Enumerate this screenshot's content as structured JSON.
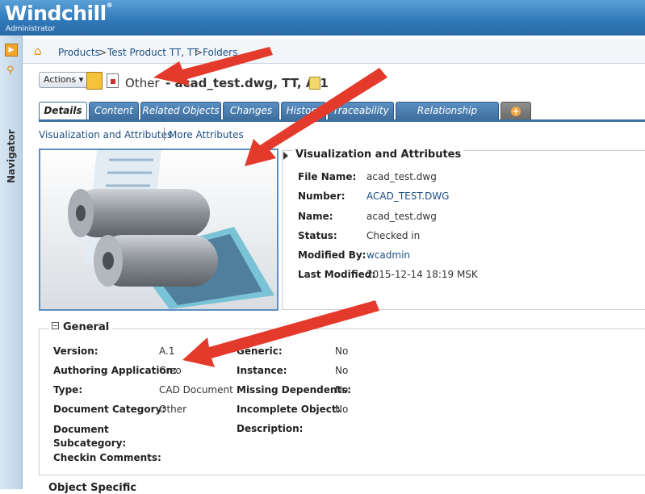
{
  "app": {
    "logo": "Windchill",
    "logo_mark": "®",
    "role": "Administrator"
  },
  "navigator": {
    "label": "Navigator"
  },
  "breadcrumb": {
    "items": [
      "Products",
      "Test Product TT, TT",
      "Folders"
    ],
    "separator": ">"
  },
  "toolbar": {
    "actions_label": "Actions"
  },
  "object": {
    "type": "Other",
    "dash": "-",
    "name": "acad_test.dwg, TT, A.1"
  },
  "tabs": [
    "Details",
    "Content",
    "Related Objects",
    "Changes",
    "History",
    "Traceability",
    "Relationship Explorer"
  ],
  "subnav": {
    "viz": "Visualization and Attributes",
    "more": "More Attributes"
  },
  "viz": {
    "title": "Visualization and Attributes",
    "rows": [
      {
        "label": "File Name:",
        "value": "acad_test.dwg"
      },
      {
        "label": "Number:",
        "value": "ACAD_TEST.DWG"
      },
      {
        "label": "Name:",
        "value": "acad_test.dwg"
      },
      {
        "label": "Status:",
        "value": "Checked in"
      },
      {
        "label": "Modified By:",
        "value": "wcadmin"
      },
      {
        "label": "Last Modified:",
        "value": "2015-12-14 18:19 MSK"
      }
    ]
  },
  "general": {
    "title": "General",
    "left": [
      {
        "label": "Version:",
        "value": "A.1"
      },
      {
        "label": "Authoring Application:",
        "value": "Creo"
      },
      {
        "label": "Type:",
        "value": "CAD Document"
      },
      {
        "label": "Document Category:",
        "value": "Other"
      },
      {
        "label": "Document Subcategory:",
        "value": ""
      },
      {
        "label": "Checkin Comments:",
        "value": ""
      }
    ],
    "right": [
      {
        "label": "Generic:",
        "value": "No"
      },
      {
        "label": "Instance:",
        "value": "No"
      },
      {
        "label": "Missing Dependents:",
        "value": "No"
      },
      {
        "label": "Incomplete Object:",
        "value": "No"
      },
      {
        "label": "Description:",
        "value": ""
      }
    ]
  },
  "next_section": "Object Specific",
  "colors": {
    "header": "#2f78b8",
    "tab": "#3e6f9e",
    "link": "#1d4f86",
    "arrow": "#e43a2c"
  },
  "icons": [
    "home-icon",
    "document-icon",
    "cad-file-icon",
    "add-tab-icon",
    "collapse-icon",
    "search-icon",
    "toggle-icon"
  ]
}
